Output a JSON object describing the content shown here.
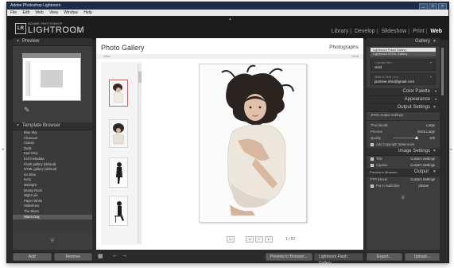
{
  "window": {
    "title": "Adobe Photoshop Lightroom"
  },
  "menu": [
    "File",
    "Edit",
    "Web",
    "View",
    "Window",
    "Help"
  ],
  "header": {
    "logo_box": "LR",
    "logo_small": "ADOBE PHOTOSHOP",
    "logo_name": "LIGHTROOM",
    "logo_version": "1.0",
    "modules": [
      "Library",
      "Develop",
      "Slideshow",
      "Print",
      "Web"
    ],
    "active_module": "Web"
  },
  "left": {
    "preview_title": "Preview",
    "template_title": "Template Browser",
    "templates": [
      "Blue Sky",
      "Charcoal",
      "Classic",
      "Dusk",
      "Earl Grey",
      "Exif metadata",
      "Flash gallery (default)",
      "HTML gallery (default)",
      "Ice Blue",
      "Ivory",
      "Midnight",
      "Mossy Rock",
      "Night Life",
      "Paper White",
      "Slideshow",
      "The Blues",
      "Warm Day"
    ],
    "selected_template_index": 16,
    "add_label": "Add",
    "remove_label": "Remove"
  },
  "center": {
    "gallery_title": "Photo Gallery",
    "gallery_right": "Photographs",
    "sub_left": "View",
    "sub_right": "Vivid",
    "page_count": "1 / 67"
  },
  "bottom": {
    "preview_browser": "Preview in Browser...",
    "gallery_type": "Lightroom Flash Gallery"
  },
  "right": {
    "gallery_header": "Gallery",
    "gallery_options": [
      "Lightroom Flash Gallery",
      "Lightroom HTML Gallery"
    ],
    "contact_label": "Contact Info",
    "contact_value": "vivid",
    "web_label": "Web or Mail Link",
    "web_value": "jasmine.shin@gmail.com",
    "color_palette": "Color Palette",
    "appearance": "Appearance",
    "output_settings": "Output Settings",
    "jpeg_label": "JPEG Output Settings",
    "thumbnails_label": "Thumbnails",
    "thumbnails_value": "Large",
    "preview_label": "Preview",
    "preview_value": "Extra Large",
    "quality_label": "Quality",
    "quality_value": "100",
    "watermark_label": "Add Copyright Watermark",
    "image_settings": "Image Settings",
    "title_label": "Title",
    "title_value": "Custom Settings",
    "caption_label": "Caption",
    "caption_value": "Custom Settings",
    "preview_browser_row": "Preview in Browser...",
    "output_header": "Output",
    "ftp_label": "FTP Server",
    "ftp_value": "Custom Settings",
    "subfolder_label": "Put in Subfolder",
    "subfolder_value": "photos",
    "export_label": "Export...",
    "upload_label": "Upload..."
  }
}
